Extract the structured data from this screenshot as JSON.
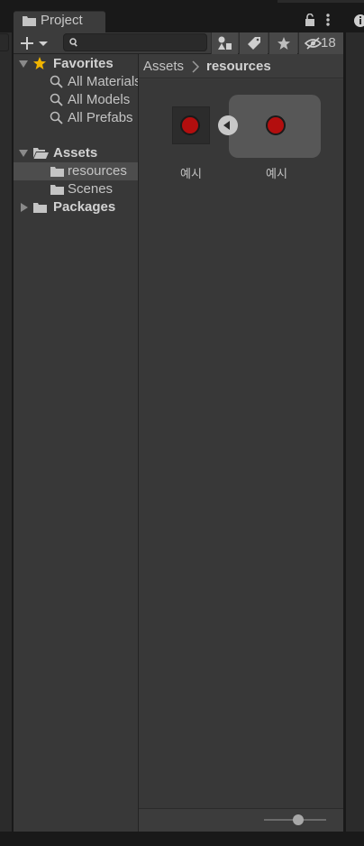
{
  "window": {
    "tab_label": "Project",
    "tab_icon": "folder-icon",
    "lock_icon": "lock-icon",
    "menu_icon": "kebab-menu-icon",
    "info_icon": "info-icon"
  },
  "toolbar": {
    "add_icon": "plus-dropdown-icon",
    "search": {
      "value": "",
      "placeholder": ""
    },
    "search_icon": "search-icon",
    "filter_type_icon": "shapes-icon",
    "filter_label_icon": "tag-icon",
    "favorites_icon": "star-icon",
    "hidden_icon": "eye-slash-icon",
    "hidden_count": "18"
  },
  "tree": {
    "favorites": {
      "label": "Favorites",
      "items": [
        {
          "label": "All Materials"
        },
        {
          "label": "All Models"
        },
        {
          "label": "All Prefabs"
        }
      ]
    },
    "assets": {
      "label": "Assets",
      "items": [
        {
          "label": "resources",
          "selected": true
        },
        {
          "label": "Scenes",
          "selected": false
        }
      ]
    },
    "packages": {
      "label": "Packages"
    }
  },
  "breadcrumb": {
    "root": "Assets",
    "current": "resources"
  },
  "assets": [
    {
      "label": "예시",
      "kind": "prefab-icon"
    },
    {
      "label": "예시",
      "kind": "prefab-expanded-icon"
    }
  ],
  "footer": {
    "zoom_level": 0.55
  },
  "colors": {
    "panel_bg": "#3c3c3c",
    "tree_bg": "#383838",
    "selection": "#4d4d4d",
    "asset_dot": "#b30e0e",
    "star": "#f0b400"
  }
}
